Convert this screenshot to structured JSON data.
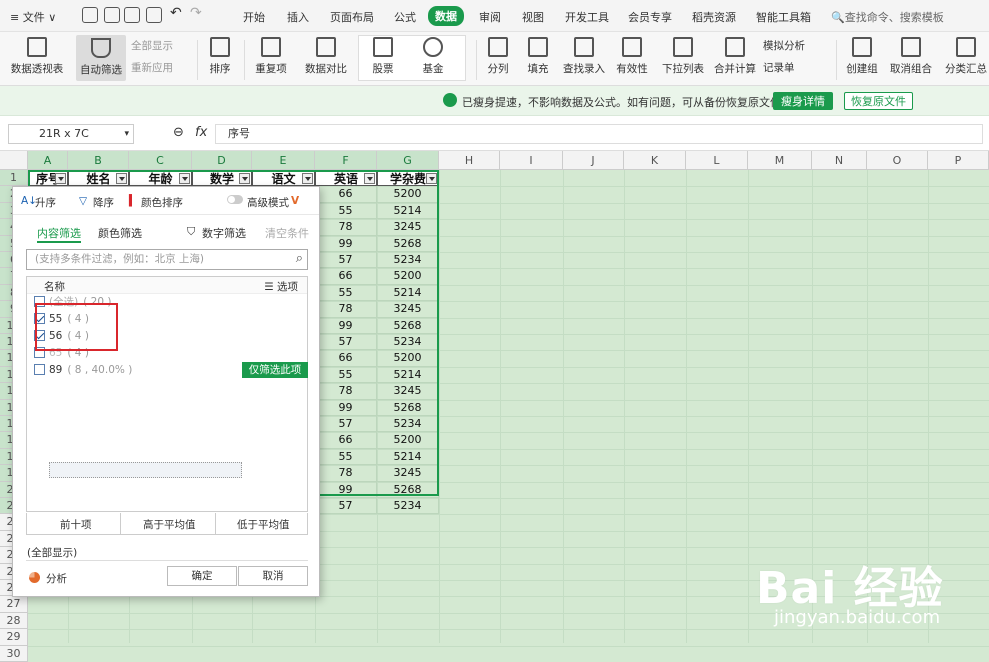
{
  "menubar": {
    "file_label": "≡ 文件 ∨",
    "tabs": [
      "开始",
      "插入",
      "页面布局",
      "公式",
      "数据",
      "审阅",
      "视图",
      "开发工具",
      "会员专享",
      "稻壳资源",
      "智能工具箱"
    ],
    "active_tab": "数据",
    "search_placeholder": "🔍查找命令、搜索模板"
  },
  "ribbon": {
    "pivot": "数据透视表",
    "autofilter": "自动筛选",
    "show_all": "全部显示",
    "reapply": "重新应用",
    "sort": "排序",
    "duplicates": "重复项",
    "compare": "数据对比",
    "stock": "股票",
    "fund": "基金",
    "split": "分列",
    "fill": "填充",
    "lookup": "查找录入",
    "validity": "有效性",
    "dropdown": "下拉列表",
    "merge_calc": "合并计算",
    "simulate": "模拟分析",
    "record": "记录单",
    "group": "创建组",
    "ungroup": "取消组合",
    "subtotal": "分类汇总"
  },
  "notice": {
    "text": "已瘦身提速，不影响数据及公式。如有问题，可从备份恢复原文件",
    "detail_button": "瘦身详情",
    "restore_button": "恢复原文件"
  },
  "formula": {
    "namebox": "21R x 7C",
    "fx": "fx",
    "content": "序号"
  },
  "grid": {
    "columns": [
      "A",
      "B",
      "C",
      "D",
      "E",
      "F",
      "G",
      "H",
      "I",
      "J",
      "K",
      "L",
      "M",
      "N",
      "O",
      "P"
    ],
    "headers": [
      "序号",
      "姓名",
      "年龄",
      "数学",
      "语文",
      "英语",
      "学杂费"
    ],
    "rows": [
      "1",
      "2",
      "3",
      "4",
      "5",
      "6",
      "7",
      "8",
      "9",
      "10",
      "11",
      "12",
      "13",
      "14",
      "15",
      "16",
      "17",
      "18",
      "19",
      "20",
      "21",
      "22",
      "23",
      "24",
      "25",
      "26",
      "27",
      "28",
      "29",
      "30"
    ],
    "col_f": [
      "66",
      "55",
      "78",
      "99",
      "57",
      "66",
      "55",
      "78",
      "99",
      "57",
      "66",
      "55",
      "78",
      "99",
      "57",
      "66",
      "55",
      "78",
      "99",
      "57"
    ],
    "col_g": [
      "5200",
      "5214",
      "3245",
      "5268",
      "5234",
      "5200",
      "5214",
      "3245",
      "5268",
      "5234",
      "5200",
      "5214",
      "3245",
      "5268",
      "5234",
      "5200",
      "5214",
      "3245",
      "5268",
      "5234"
    ]
  },
  "filter_popup": {
    "asc": "升序",
    "desc": "降序",
    "color_sort": "颜色排序",
    "advanced": "高级模式",
    "tab_content": "内容筛选",
    "tab_color": "颜色筛选",
    "number_filter": "数字筛选",
    "clear": "清空条件",
    "search_placeholder": "(支持多条件过滤，例如：北京  上海)",
    "list_header": "名称",
    "options": "☰ 选项",
    "items": [
      {
        "label": "(全选)",
        "count": "( 20 )"
      },
      {
        "label": "55",
        "count": "( 4 )"
      },
      {
        "label": "56",
        "count": "( 4 )"
      },
      {
        "label": "65",
        "count": "( 4 )"
      },
      {
        "label": "89",
        "count": "( 8 , 40.0% )"
      }
    ],
    "only_this": "仅筛选此项",
    "top10": "前十项",
    "above_avg": "高于平均值",
    "below_avg": "低于平均值",
    "show_all": "(全部显示)",
    "analysis": "分析",
    "ok": "确定",
    "cancel": "取消"
  },
  "watermark": {
    "brand": "Bai 经验",
    "url": "jingyan.baidu.com"
  }
}
